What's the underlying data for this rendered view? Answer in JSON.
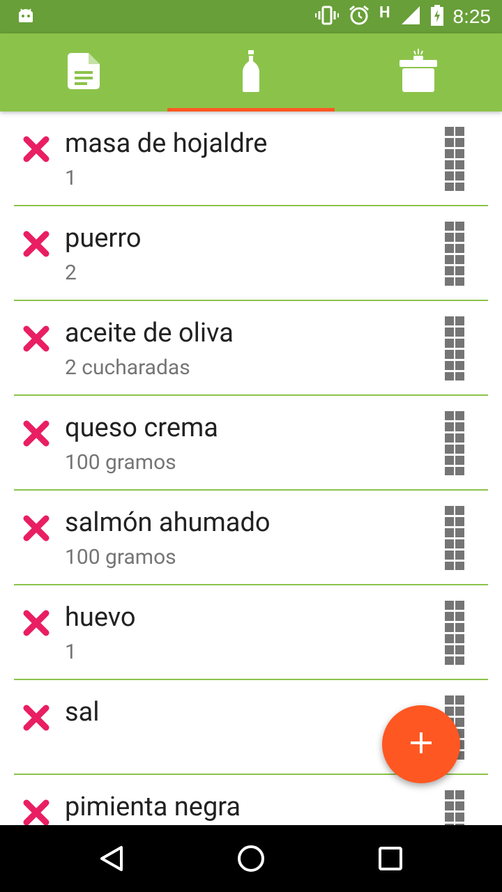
{
  "status_bar": {
    "time": "8:25",
    "network": "H",
    "icons": [
      "android-icon",
      "vibrate-icon",
      "alarm-icon",
      "signal-icon",
      "battery-charging-icon"
    ]
  },
  "tabs": [
    {
      "name": "tab-recipe",
      "icon": "document-icon",
      "selected": false
    },
    {
      "name": "tab-ingredients",
      "icon": "bottle-icon",
      "selected": true
    },
    {
      "name": "tab-cooking",
      "icon": "pot-icon",
      "selected": false
    }
  ],
  "colors": {
    "status_bar": "#689f38",
    "primary": "#8bc34a",
    "accent": "#ff5722",
    "delete": "#e91e63",
    "handle": "#757575"
  },
  "ingredients": [
    {
      "name": "masa de hojaldre",
      "quantity": "1"
    },
    {
      "name": "puerro",
      "quantity": "2"
    },
    {
      "name": "aceite de oliva",
      "quantity": "2 cucharadas"
    },
    {
      "name": "queso crema",
      "quantity": "100 gramos"
    },
    {
      "name": "salmón ahumado",
      "quantity": "100 gramos"
    },
    {
      "name": "huevo",
      "quantity": "1"
    },
    {
      "name": "sal",
      "quantity": ""
    },
    {
      "name": "pimienta negra",
      "quantity": ""
    }
  ],
  "fab": {
    "icon": "plus-icon"
  },
  "nav": {
    "icons": [
      "back-icon",
      "home-icon",
      "recents-icon"
    ]
  }
}
